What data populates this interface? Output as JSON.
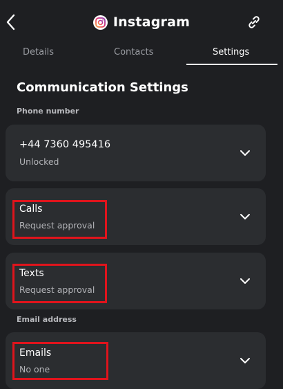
{
  "header": {
    "title": "Instagram",
    "back_icon": "chevron-left-icon",
    "app_icon": "instagram-icon",
    "link_icon": "link-icon"
  },
  "tabs": [
    {
      "label": "Details",
      "active": false
    },
    {
      "label": "Contacts",
      "active": false
    },
    {
      "label": "Settings",
      "active": true
    }
  ],
  "section_title": "Communication Settings",
  "groups": {
    "phone_label": "Phone number",
    "email_label": "Email address"
  },
  "cards": {
    "phone": {
      "label": "+44 7360 495416",
      "value": "Unlocked"
    },
    "calls": {
      "label": "Calls",
      "value": "Request approval"
    },
    "texts": {
      "label": "Texts",
      "value": "Request approval"
    },
    "emails": {
      "label": "Emails",
      "value": "No one"
    }
  },
  "colors": {
    "background": "#1e1f22",
    "card": "#2b2d30",
    "highlight": "#e0141c"
  }
}
